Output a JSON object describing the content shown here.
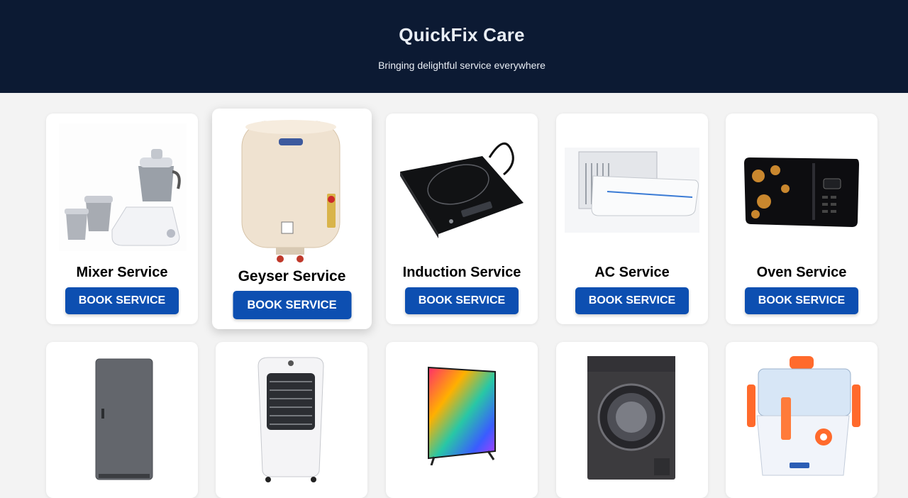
{
  "header": {
    "title": "QuickFix Care",
    "tagline": "Bringing delightful service everywhere"
  },
  "button_label": "BOOK SERVICE",
  "colors": {
    "header_bg": "#0c1a33",
    "page_bg": "#f3f3f3",
    "button_bg": "#0d4fb1"
  },
  "services": [
    {
      "title": "Mixer Service",
      "image": "mixer-grinder-image"
    },
    {
      "title": "Geyser Service",
      "image": "water-heater-image"
    },
    {
      "title": "Induction Service",
      "image": "induction-cooktop-image"
    },
    {
      "title": "AC Service",
      "image": "air-conditioner-image"
    },
    {
      "title": "Oven Service",
      "image": "microwave-oven-image"
    },
    {
      "title": "",
      "image": "refrigerator-image"
    },
    {
      "title": "",
      "image": "air-cooler-image"
    },
    {
      "title": "",
      "image": "television-image"
    },
    {
      "title": "",
      "image": "washing-machine-image"
    },
    {
      "title": "",
      "image": "juicer-image"
    }
  ]
}
